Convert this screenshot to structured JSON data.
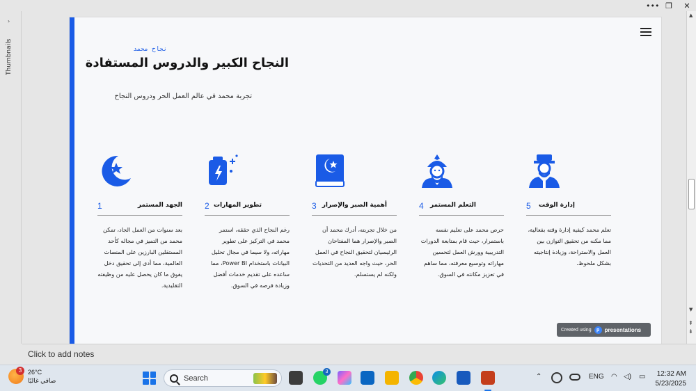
{
  "window": {
    "controls": [
      "more",
      "restore",
      "close"
    ]
  },
  "thumbnails": {
    "label": "Thumbnails"
  },
  "slide": {
    "eyebrow": "نجاح محمد",
    "title": "النجاح الكبير والدروس المستفادة",
    "subtitle": "تجربة محمد في عالم العمل الحر ودروس النجاح",
    "accent_color": "#1a5be6",
    "cards": [
      {
        "num": "1",
        "title": "الجهد المستمر",
        "icon": "crescent-star-icon",
        "body": "بعد سنوات من العمل الجاد، تمكن محمد من التميز في مجاله كأحد المستقلين البارزين على المنصات العالمية، مما أدى إلى تحقيق دخل يفوق ما كان يحصل عليه من وظيفته التقليدية."
      },
      {
        "num": "2",
        "title": "تطوير المهارات",
        "icon": "lantern-icon",
        "body": "رغم النجاح الذي حققه، استمر محمد في التركيز على تطوير مهاراته، ولا سيما في مجال تحليل البيانات باستخدام Power BI، مما ساعده على تقديم خدمات أفضل وزيادة فرصه في السوق."
      },
      {
        "num": "3",
        "title": "أهمية الصبر والإصرار",
        "icon": "quran-book-icon",
        "body": "من خلال تجربته، أدرك محمد أن الصبر والإصرار هما المفتاحان الرئيسيان لتحقيق النجاح في العمل الحر، حيث واجه العديد من التحديات ولكنه لم يستسلم."
      },
      {
        "num": "4",
        "title": "التعلم المستمر",
        "icon": "imam-icon",
        "body": "حرص محمد على تعليم نفسه باستمرار، حيث قام بمتابعة الدورات التدريبية وورش العمل لتحسين مهاراته وتوسيع معرفته، مما ساهم في تعزيز مكانته في السوق."
      },
      {
        "num": "5",
        "title": "إدارة الوقت",
        "icon": "man-with-cap-icon",
        "body": "تعلم محمد كيفية إدارة وقته بفعالية، مما مكنه من تحقيق التوازن بين العمل والاستراحة، وزيادة إنتاجيته بشكل ملحوظ."
      }
    ],
    "badge": {
      "prefix": "Created using",
      "brand": "presentations"
    }
  },
  "notes": {
    "placeholder": "Click to add notes"
  },
  "taskbar": {
    "weather": {
      "temp": "26°C",
      "desc": "صافي غالبًا",
      "alerts": "3"
    },
    "search_label": "Search",
    "whatsapp_count": "3",
    "language": "ENG",
    "time": "12:32 AM",
    "date": "5/23/2025"
  }
}
